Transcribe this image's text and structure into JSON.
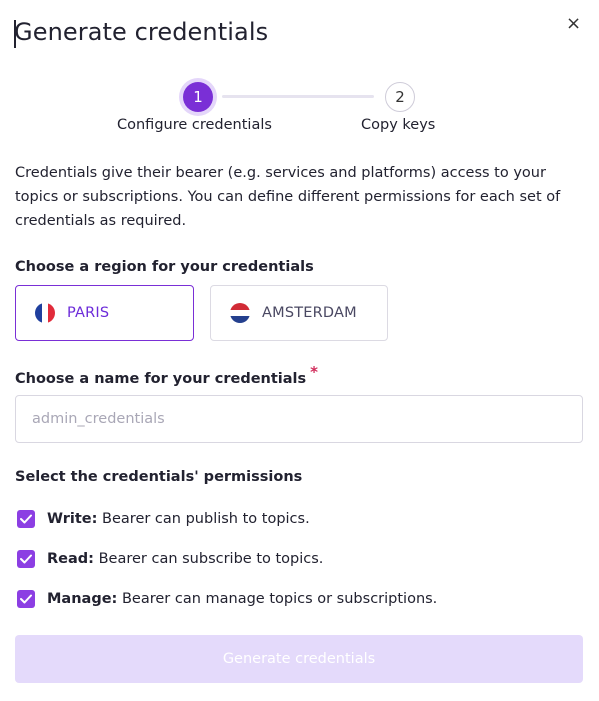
{
  "dialog": {
    "title": "Generate credentials",
    "close_icon": "close-icon",
    "close_glyph": "×"
  },
  "stepper": {
    "steps": [
      {
        "number": "1",
        "label": "Configure credentials",
        "state": "active"
      },
      {
        "number": "2",
        "label": "Copy keys",
        "state": "inactive"
      }
    ]
  },
  "description": "Credentials give their bearer (e.g. services and platforms) access to your topics or subscriptions. You can define different permissions for each set of credentials as required.",
  "region": {
    "label": "Choose a region for your credentials",
    "options": [
      {
        "name": "PARIS",
        "flag_icon": "france-flag-icon",
        "selected": true
      },
      {
        "name": "AMSTERDAM",
        "flag_icon": "netherlands-flag-icon",
        "selected": false
      }
    ]
  },
  "name": {
    "label": "Choose a name for your credentials",
    "required_mark": "*",
    "placeholder": "admin_credentials",
    "value": ""
  },
  "permissions": {
    "label": "Select the credentials' permissions",
    "items": [
      {
        "name": "Write:",
        "description": " Bearer can publish to topics.",
        "checked": true
      },
      {
        "name": "Read:",
        "description": " Bearer can subscribe to topics.",
        "checked": true
      },
      {
        "name": "Manage:",
        "description": " Bearer can manage topics or subscriptions.",
        "checked": true
      }
    ]
  },
  "submit": {
    "label": "Generate credentials",
    "disabled": true
  },
  "colors": {
    "accent": "#7a2fd6",
    "checkbox": "#8c3ee3",
    "required": "#d12c5b",
    "submit_disabled_bg": "#e4dafb"
  }
}
